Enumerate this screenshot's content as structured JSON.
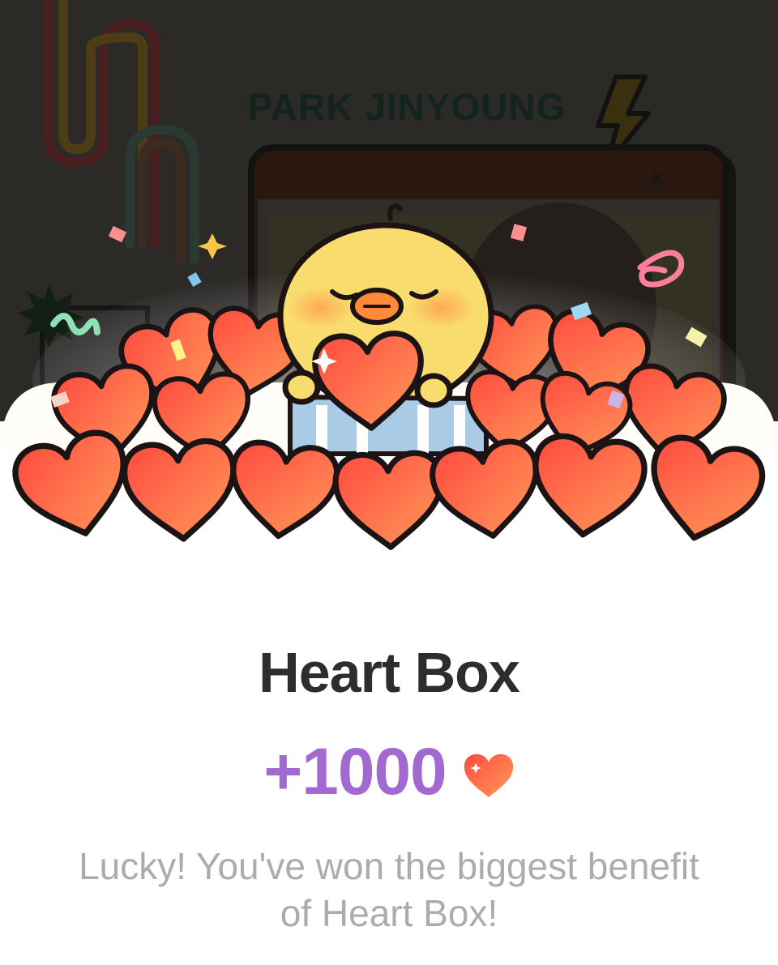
{
  "background": {
    "poster_title": "PARK JINYOUNG",
    "overlay_color": "#2b2a27"
  },
  "popup": {
    "title": "Heart Box",
    "reward_amount": "+1000",
    "reward_icon": "heart-icon",
    "message": "Lucky! You've won the biggest benefit of Heart Box!"
  },
  "colors": {
    "title": "#2d2d2d",
    "reward": "#a26ad1",
    "message": "#acacac",
    "heart_light": "#ff9a5a",
    "heart_dark": "#ff4a3f",
    "chick": "#f9dc6e"
  }
}
